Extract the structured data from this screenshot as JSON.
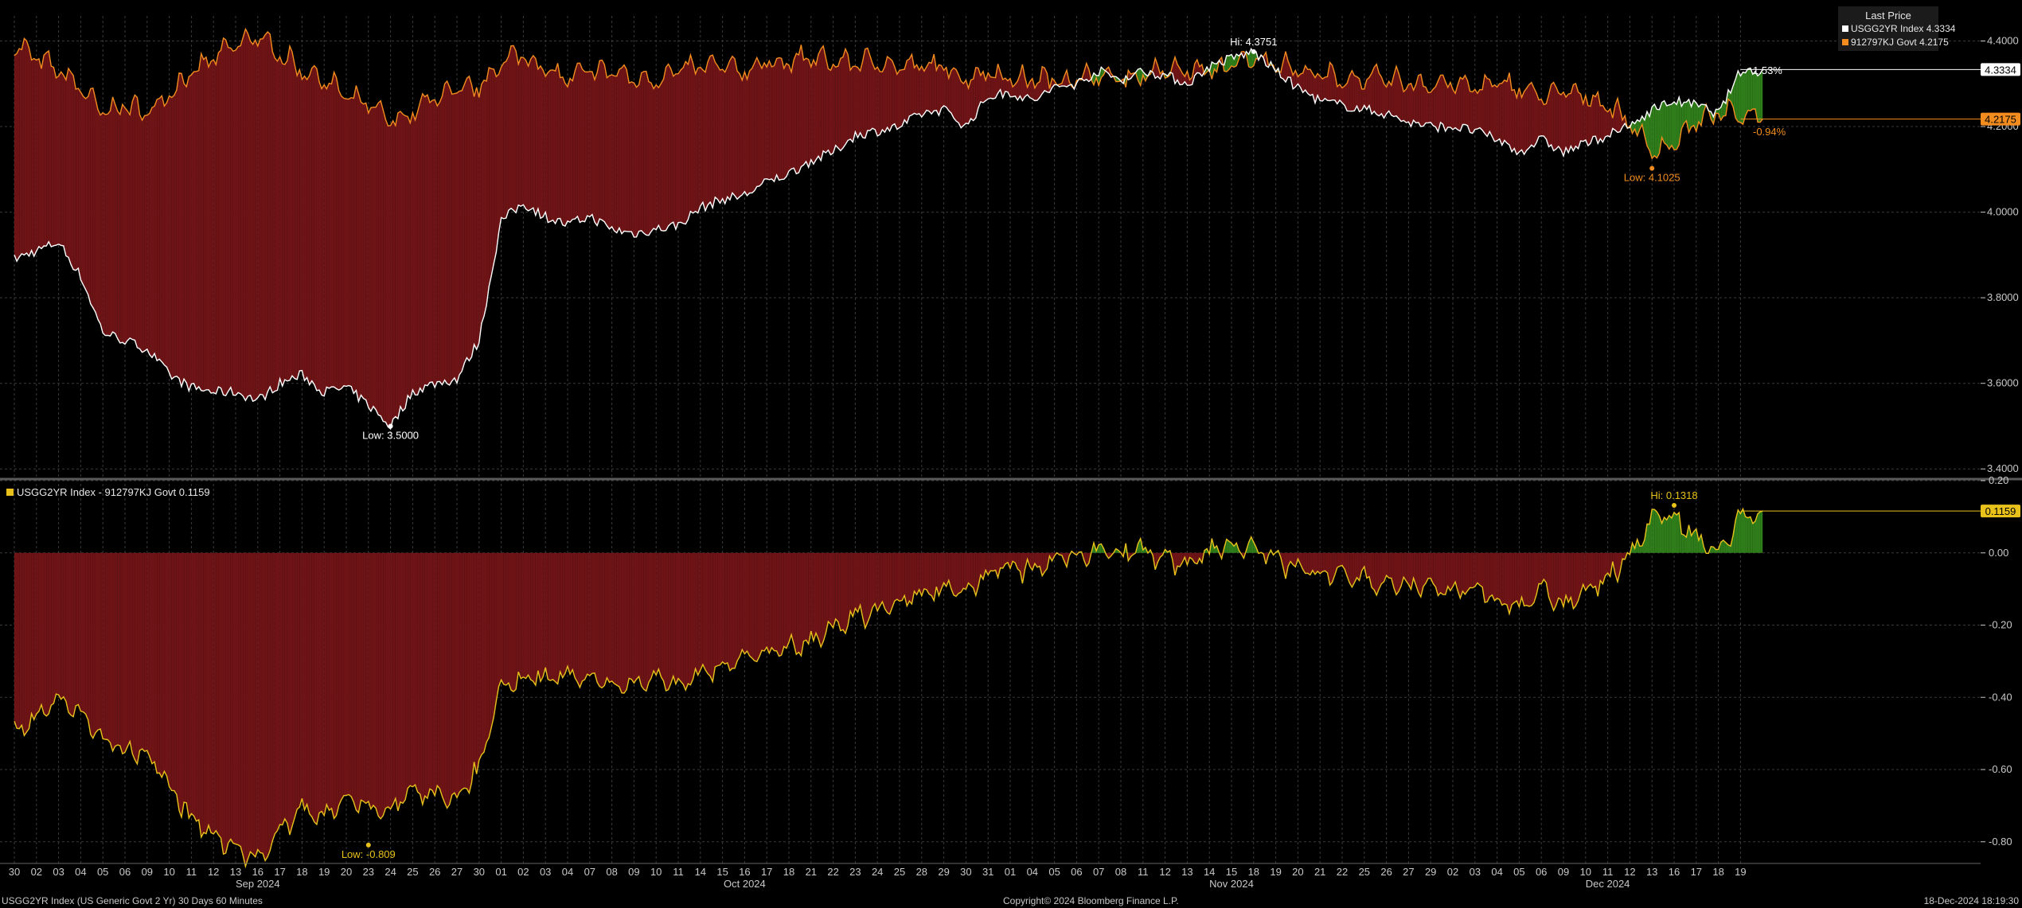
{
  "legend": {
    "header": "Last Price",
    "upper_series": [
      {
        "label": "USGG2YR Index",
        "value": "4.3334",
        "color": "#ffffff"
      },
      {
        "label": "912797KJ Govt",
        "value": "4.2175",
        "color": "#f28c1e"
      }
    ],
    "lower_series": {
      "label": "USGG2YR Index - 912797KJ Govt",
      "value": "0.1159",
      "color": "#e8c21b"
    }
  },
  "footer": {
    "left": "USGG2YR Index (US Generic Govt 2 Yr) 30 Days 60 Minutes",
    "center": "Copyright© 2024 Bloomberg Finance L.P.",
    "right": "18-Dec-2024 18:19:30"
  },
  "colors": {
    "background": "#000000",
    "red_fill": "#6e1416",
    "green_fill": "#2f7d1a",
    "white_line": "#ffffff",
    "orange_line": "#f28c1e",
    "yellow_line": "#e8c21b",
    "grid": "#3a3a3a",
    "axis_text": "#c8c8c8"
  },
  "chart_data": [
    {
      "type": "line",
      "panel": "upper",
      "series": [
        {
          "name": "USGG2YR Index"
        },
        {
          "name": "912797KJ Govt"
        }
      ],
      "x_tick_labels": [
        "30",
        "02",
        "03",
        "04",
        "05",
        "06",
        "09",
        "10",
        "11",
        "12",
        "13",
        "16",
        "17",
        "18",
        "19",
        "20",
        "23",
        "24",
        "25",
        "26",
        "27",
        "30",
        "01",
        "02",
        "03",
        "04",
        "07",
        "08",
        "09",
        "10",
        "11",
        "14",
        "15",
        "16",
        "17",
        "18",
        "21",
        "22",
        "23",
        "24",
        "25",
        "28",
        "29",
        "30",
        "31",
        "01",
        "04",
        "05",
        "06",
        "07",
        "08",
        "11",
        "12",
        "13",
        "14",
        "15",
        "18",
        "19",
        "20",
        "21",
        "22",
        "25",
        "26",
        "27",
        "29",
        "02",
        "03",
        "04",
        "05",
        "06",
        "09",
        "10",
        "11",
        "12",
        "13",
        "16",
        "17",
        "18",
        "19"
      ],
      "x_month_labels": [
        {
          "label": "Sep 2024",
          "at_index": 11
        },
        {
          "label": "Oct 2024",
          "at_index": 33
        },
        {
          "label": "Nov 2024",
          "at_index": 55
        },
        {
          "label": "Dec 2024",
          "at_index": 72
        }
      ],
      "ylim": [
        3.38,
        4.44
      ],
      "yticks": [
        "3.4000",
        "3.6000",
        "3.8000",
        "4.0000",
        "4.2000",
        "4.4000"
      ],
      "keypoints": [
        {
          "i": 0,
          "w": 3.89,
          "o": 4.38
        },
        {
          "i": 2,
          "w": 3.93,
          "o": 4.32
        },
        {
          "i": 3,
          "w": 3.85,
          "o": 4.28
        },
        {
          "i": 4,
          "w": 3.72,
          "o": 4.22
        },
        {
          "i": 5,
          "w": 3.7,
          "o": 4.24
        },
        {
          "i": 6,
          "w": 3.68,
          "o": 4.22
        },
        {
          "i": 7,
          "w": 3.62,
          "o": 4.27
        },
        {
          "i": 8,
          "w": 3.59,
          "o": 4.31
        },
        {
          "i": 9,
          "w": 3.58,
          "o": 4.35
        },
        {
          "i": 10,
          "w": 3.58,
          "o": 4.38
        },
        {
          "i": 11,
          "w": 3.56,
          "o": 4.4
        },
        {
          "i": 12,
          "w": 3.6,
          "o": 4.36
        },
        {
          "i": 13,
          "w": 3.62,
          "o": 4.32
        },
        {
          "i": 14,
          "w": 3.58,
          "o": 4.3
        },
        {
          "i": 15,
          "w": 3.59,
          "o": 4.26
        },
        {
          "i": 16,
          "w": 3.55,
          "o": 4.24
        },
        {
          "i": 17,
          "w": 3.5,
          "o": 4.2
        },
        {
          "i": 18,
          "w": 3.58,
          "o": 4.22
        },
        {
          "i": 19,
          "w": 3.6,
          "o": 4.26
        },
        {
          "i": 20,
          "w": 3.61,
          "o": 4.27
        },
        {
          "i": 21,
          "w": 3.7,
          "o": 4.28
        },
        {
          "i": 22,
          "w": 3.98,
          "o": 4.34
        },
        {
          "i": 23,
          "w": 4.02,
          "o": 4.36
        },
        {
          "i": 24,
          "w": 3.99,
          "o": 4.32
        },
        {
          "i": 25,
          "w": 3.97,
          "o": 4.3
        },
        {
          "i": 26,
          "w": 3.99,
          "o": 4.32
        },
        {
          "i": 27,
          "w": 3.96,
          "o": 4.32
        },
        {
          "i": 28,
          "w": 3.95,
          "o": 4.3
        },
        {
          "i": 29,
          "w": 3.96,
          "o": 4.3
        },
        {
          "i": 30,
          "w": 3.97,
          "o": 4.32
        },
        {
          "i": 31,
          "w": 4.01,
          "o": 4.33
        },
        {
          "i": 32,
          "w": 4.03,
          "o": 4.33
        },
        {
          "i": 33,
          "w": 4.04,
          "o": 4.32
        },
        {
          "i": 34,
          "w": 4.07,
          "o": 4.34
        },
        {
          "i": 35,
          "w": 4.09,
          "o": 4.34
        },
        {
          "i": 36,
          "w": 4.12,
          "o": 4.35
        },
        {
          "i": 37,
          "w": 4.14,
          "o": 4.34
        },
        {
          "i": 38,
          "w": 4.18,
          "o": 4.34
        },
        {
          "i": 39,
          "w": 4.19,
          "o": 4.34
        },
        {
          "i": 40,
          "w": 4.2,
          "o": 4.33
        },
        {
          "i": 41,
          "w": 4.23,
          "o": 4.33
        },
        {
          "i": 42,
          "w": 4.24,
          "o": 4.33
        },
        {
          "i": 43,
          "w": 4.2,
          "o": 4.3
        },
        {
          "i": 44,
          "w": 4.27,
          "o": 4.32
        },
        {
          "i": 45,
          "w": 4.28,
          "o": 4.3
        },
        {
          "i": 46,
          "w": 4.26,
          "o": 4.3
        },
        {
          "i": 47,
          "w": 4.29,
          "o": 4.3
        },
        {
          "i": 48,
          "w": 4.3,
          "o": 4.3
        },
        {
          "i": 49,
          "w": 4.33,
          "o": 4.31
        },
        {
          "i": 50,
          "w": 4.31,
          "o": 4.3
        },
        {
          "i": 51,
          "w": 4.33,
          "o": 4.31
        },
        {
          "i": 52,
          "w": 4.32,
          "o": 4.32
        },
        {
          "i": 53,
          "w": 4.3,
          "o": 4.32
        },
        {
          "i": 54,
          "w": 4.34,
          "o": 4.32
        },
        {
          "i": 55,
          "w": 4.36,
          "o": 4.33
        },
        {
          "i": 56,
          "w": 4.3751,
          "o": 4.35
        },
        {
          "i": 57,
          "w": 4.33,
          "o": 4.34
        },
        {
          "i": 58,
          "w": 4.29,
          "o": 4.32
        },
        {
          "i": 59,
          "w": 4.26,
          "o": 4.31
        },
        {
          "i": 60,
          "w": 4.25,
          "o": 4.3
        },
        {
          "i": 61,
          "w": 4.24,
          "o": 4.3
        },
        {
          "i": 62,
          "w": 4.23,
          "o": 4.3
        },
        {
          "i": 63,
          "w": 4.21,
          "o": 4.29
        },
        {
          "i": 64,
          "w": 4.2,
          "o": 4.29
        },
        {
          "i": 65,
          "w": 4.2,
          "o": 4.29
        },
        {
          "i": 66,
          "w": 4.19,
          "o": 4.28
        },
        {
          "i": 67,
          "w": 4.17,
          "o": 4.29
        },
        {
          "i": 68,
          "w": 4.14,
          "o": 4.28
        },
        {
          "i": 69,
          "w": 4.17,
          "o": 4.26
        },
        {
          "i": 70,
          "w": 4.14,
          "o": 4.27
        },
        {
          "i": 71,
          "w": 4.16,
          "o": 4.26
        },
        {
          "i": 72,
          "w": 4.18,
          "o": 4.24
        },
        {
          "i": 73,
          "w": 4.2,
          "o": 4.2
        },
        {
          "i": 74,
          "w": 4.24,
          "o": 4.13
        },
        {
          "i": 75,
          "w": 4.26,
          "o": 4.15
        },
        {
          "i": 76,
          "w": 4.25,
          "o": 4.2
        },
        {
          "i": 77,
          "w": 4.23,
          "o": 4.22
        },
        {
          "i": 78,
          "w": 4.33,
          "o": 4.2175
        }
      ],
      "annotations": [
        {
          "text": "Hi: 4.3751",
          "series": "USGG2YR Index",
          "at_index": 56,
          "value": 4.3751
        },
        {
          "text": "Low: 3.5000",
          "series": "USGG2YR Index",
          "at_index": 17,
          "value": 3.5
        },
        {
          "text": "Low: 4.1025",
          "series": "912797KJ Govt",
          "at_index": 74,
          "value": 4.1025
        },
        {
          "text": "1.53%",
          "near": "USGG2YR Index last"
        },
        {
          "text": "-0.94%",
          "near": "912797KJ Govt last"
        }
      ],
      "last_tags": [
        {
          "text": "4.3334",
          "value": 4.3334,
          "style": "white"
        },
        {
          "text": "4.2175",
          "value": 4.2175,
          "style": "orange"
        }
      ]
    },
    {
      "type": "area",
      "panel": "lower",
      "series": [
        {
          "name": "USGG2YR Index - 912797KJ Govt"
        }
      ],
      "ylim": [
        -0.86,
        0.2
      ],
      "yticks": [
        "0.20",
        "0.00",
        "-0.20",
        "-0.40",
        "-0.60",
        "-0.80"
      ],
      "annotations": [
        {
          "text": "Hi: 0.1318",
          "at_index": 75,
          "value": 0.1318
        },
        {
          "text": "Low: -0.809",
          "at_index": 16,
          "value": -0.809
        }
      ],
      "last_tags": [
        {
          "text": "0.1159",
          "value": 0.1159,
          "style": "yellow"
        }
      ]
    }
  ]
}
